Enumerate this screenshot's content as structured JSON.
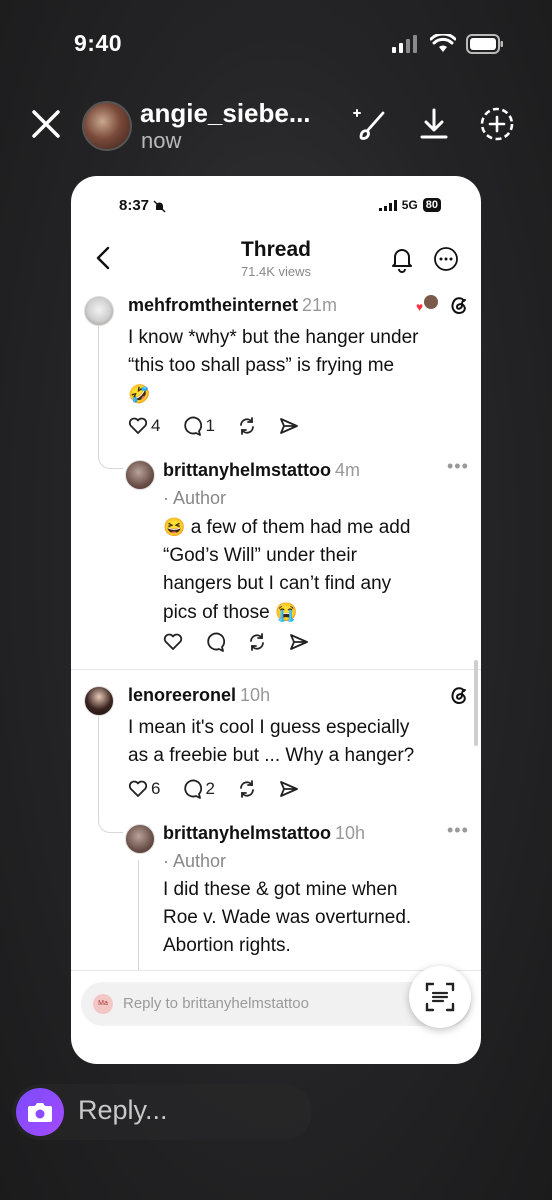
{
  "status_bar": {
    "time": "9:40"
  },
  "story": {
    "username": "angie_siebe...",
    "timestamp": "now"
  },
  "card": {
    "status_time": "8:37",
    "network": "5G",
    "battery": "80",
    "title": "Thread",
    "views": "71.4K views",
    "posts": [
      {
        "username": "mehfromtheinternet",
        "age": "21m",
        "line1": "I know *why* but the hanger under",
        "line2": "“this too shall pass” is frying me",
        "emoji": "🤣",
        "likes": "4",
        "replies": "1"
      },
      {
        "username": "brittanyhelmstattoo",
        "age": "4m",
        "author": "· Author",
        "line1": "a few of them had me add",
        "line1_emoji": "😆",
        "line2": "“God’s Will” under their",
        "line3": "hangers but I can’t find any",
        "line4": "pics of those",
        "line4_emoji": "😭"
      },
      {
        "username": "lenoreeronel",
        "age": "10h",
        "line1": "I mean it's cool I guess especially",
        "line2": "as a freebie but ... Why a hanger?",
        "likes": "6",
        "replies": "2"
      },
      {
        "username": "brittanyhelmstattoo",
        "age": "10h",
        "author": "· Author",
        "line1": "I did these & got mine when",
        "line2": "Roe v. Wade was overturned.",
        "line3": "Abortion rights."
      }
    ],
    "reply_placeholder": "Reply to brittanyhelmstattoo",
    "reply_avatar_text": "Ma"
  },
  "bottom": {
    "reply_placeholder": "Reply..."
  }
}
